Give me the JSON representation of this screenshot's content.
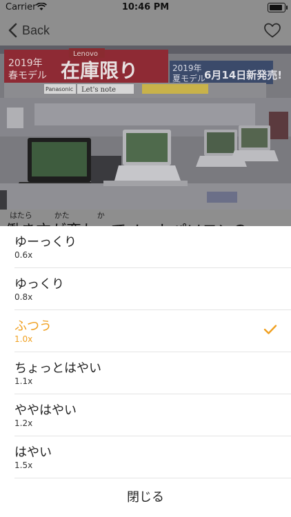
{
  "status_bar": {
    "carrier": "Carrier",
    "time": "10:46 PM"
  },
  "nav": {
    "back_label": "Back"
  },
  "article": {
    "ruby": [
      "はたら",
      "かた",
      "か"
    ],
    "title_peek": "働き方が変わってノートパソコンの"
  },
  "photo": {
    "sign1_year": "2019年",
    "sign1_season": "春モデル",
    "sign1_main": "在庫限り",
    "sign2_year": "2019年",
    "sign2_season": "夏モデル",
    "sign2_main": "6月14日新発売!",
    "brand": "Lenovo",
    "model_tag": "Let's note",
    "panasonic": "Panasonic"
  },
  "speed_options": [
    {
      "label": "ゆーっくり",
      "rate": "0.6x",
      "selected": false
    },
    {
      "label": "ゆっくり",
      "rate": "0.8x",
      "selected": false
    },
    {
      "label": "ふつう",
      "rate": "1.0x",
      "selected": true
    },
    {
      "label": "ちょっとはやい",
      "rate": "1.1x",
      "selected": false
    },
    {
      "label": "ややはやい",
      "rate": "1.2x",
      "selected": false
    },
    {
      "label": "はやい",
      "rate": "1.5x",
      "selected": false
    }
  ],
  "close_label": "閉じる",
  "colors": {
    "accent": "#f0a020",
    "overlay": "#8e8e8e"
  }
}
